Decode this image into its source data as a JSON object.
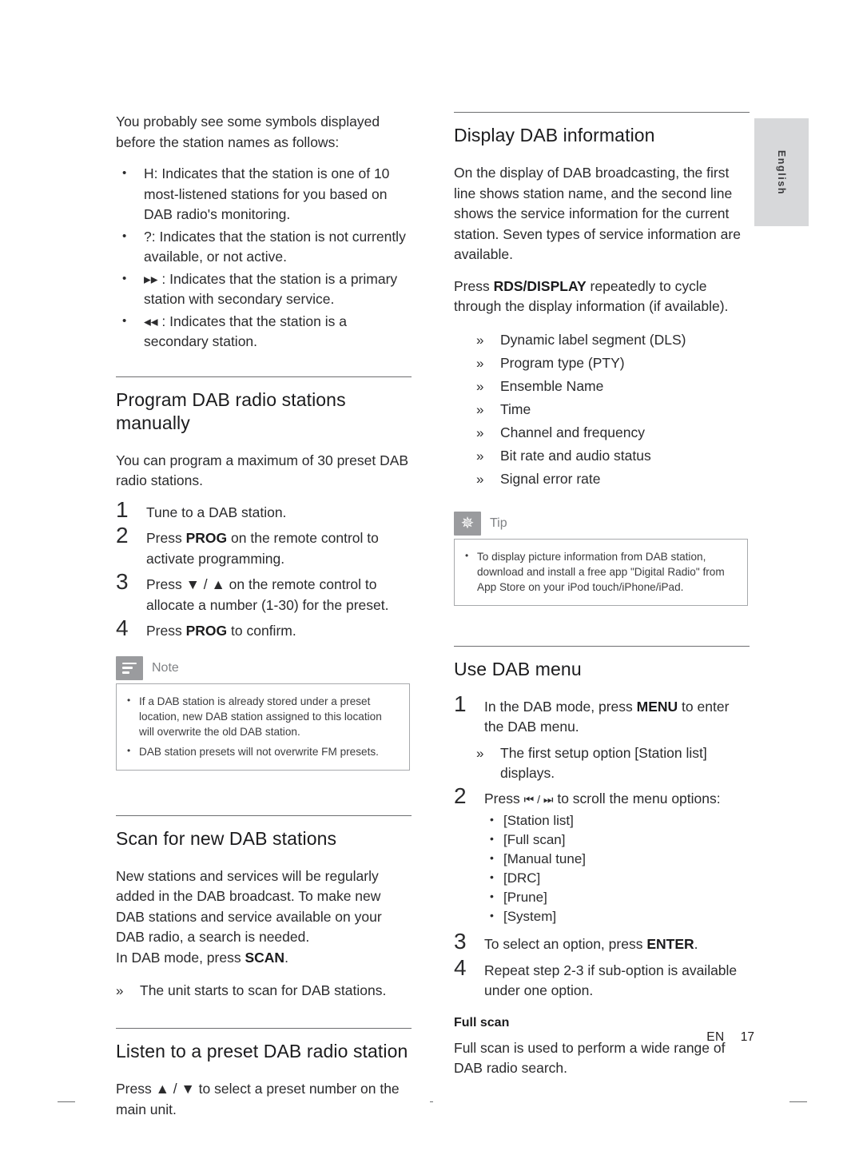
{
  "side_tab": {
    "label": "English"
  },
  "left_column": {
    "intro": "You probably see some symbols displayed before the station names as follows:",
    "symbol_list": [
      "H: Indicates that the station is one of 10 most-listened stations for you based on DAB radio's monitoring.",
      "?: Indicates that the station is not currently available, or not active.",
      "▸▸ : Indicates that the station is a primary station with secondary service.",
      "◂◂ : Indicates that the station is a secondary station."
    ],
    "program_section": {
      "heading": "Program DAB radio stations manually",
      "intro": "You can program a maximum of 30 preset DAB radio stations.",
      "steps": [
        {
          "num": "1",
          "text": "Tune to a DAB station."
        },
        {
          "num": "2",
          "text": "Press PROG on the remote control to activate programming.",
          "bold": "PROG"
        },
        {
          "num": "3",
          "text": "Press ▼ / ▲ on the remote control to allocate a number (1-30) for the preset."
        },
        {
          "num": "4",
          "text": "Press PROG to confirm.",
          "bold": "PROG"
        }
      ]
    },
    "note": {
      "title": "Note",
      "icon": "note-icon",
      "items": [
        "If a DAB station is already stored under a preset location, new DAB station assigned to this location will overwrite the old DAB station.",
        "DAB station presets will not overwrite FM presets."
      ]
    },
    "scan_section": {
      "heading": "Scan for new DAB stations",
      "paragraph": "New stations and services will be regularly added in the DAB broadcast. To make new DAB stations and service available on your DAB radio, a search is needed.",
      "line2_pre": "In DAB mode, press ",
      "line2_bold": "SCAN",
      "line2_post": ".",
      "result": "The unit starts to scan for DAB stations."
    },
    "listen_section": {
      "heading": "Listen to a preset DAB radio station",
      "paragraph": "Press ▲ / ▼ to select a preset number on the main unit."
    }
  },
  "right_column": {
    "display_section": {
      "heading": "Display DAB information",
      "paragraph1": "On the display of DAB broadcasting, the first line shows station name, and the second line shows the service information for the current station. Seven types of service information are available.",
      "paragraph2_pre": "Press ",
      "paragraph2_bold": "RDS/DISPLAY",
      "paragraph2_post": " repeatedly to cycle through the display information (if available).",
      "items": [
        "Dynamic label segment (DLS)",
        "Program type (PTY)",
        "Ensemble Name",
        "Time",
        "Channel and frequency",
        "Bit rate and audio status",
        "Signal error rate"
      ]
    },
    "tip": {
      "title": "Tip",
      "icon": "asterisk-icon",
      "items": [
        "To display picture information from DAB station, download and install a free app \"Digital Radio\" from App Store on your iPod touch/iPhone/iPad."
      ]
    },
    "menu_section": {
      "heading": "Use DAB menu",
      "step1": {
        "num": "1",
        "pre": "In the DAB mode, press ",
        "bold": "MENU",
        "post": " to enter the DAB menu."
      },
      "step1_result": "The first setup option [Station list] displays.",
      "step2": {
        "num": "2",
        "pre": "Press ",
        "icons": "⏮ / ⏭",
        "post": " to scroll the menu options:"
      },
      "menu_options": [
        "[Station list]",
        "[Full scan]",
        "[Manual tune]",
        "[DRC]",
        "[Prune]",
        "[System]"
      ],
      "step3": {
        "num": "3",
        "pre": "To select an option, press ",
        "bold": "ENTER",
        "post": "."
      },
      "step4": {
        "num": "4",
        "text": "Repeat step 2-3 if sub-option is available under one option."
      },
      "subhead": "Full scan",
      "sub_paragraph": "Full scan is used to perform a wide range of DAB radio search."
    }
  },
  "footer": {
    "en": "EN",
    "page": "17"
  }
}
